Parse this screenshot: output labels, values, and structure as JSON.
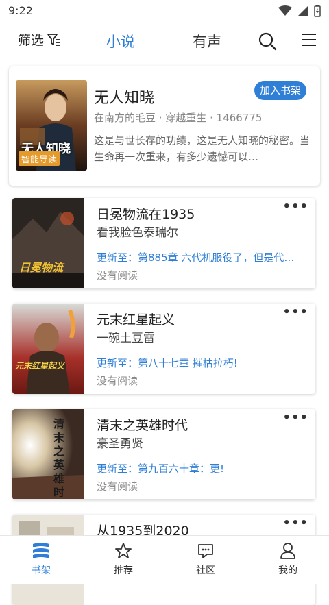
{
  "status": {
    "time": "9:22"
  },
  "topnav": {
    "filter_label": "筛选",
    "tabs": [
      "小说",
      "有声"
    ]
  },
  "featured": {
    "title": "无人知晓",
    "meta": "在南方的毛豆 · 穿越重生 · 1466775",
    "description": "这是与世长存的功绩，这是无人知晓的秘密。当生命再一次重来，有多少遗憾可以…",
    "add_label": "加入书架",
    "cover_title": "无人知晓",
    "cover_badge": "智能导读"
  },
  "books": [
    {
      "title": "日冕物流在1935",
      "author": "看我脸色泰瑞尔",
      "update": "更新至：第885章 六代机服役了，但是代…",
      "read_status": "没有阅读",
      "cover_text": "日冕物流"
    },
    {
      "title": "元末红星起义",
      "author": "一碗土豆雷",
      "update": "更新至：第八十七章 摧枯拉朽!",
      "read_status": "没有阅读",
      "cover_text": "元末红星起义"
    },
    {
      "title": "清末之英雄时代",
      "author": "豪圣勇贤",
      "update": "更新至：第九百六十章：更!",
      "read_status": "没有阅读",
      "cover_text": "清末之英雄时代"
    },
    {
      "title": "从1935到2020",
      "author": "",
      "update": "",
      "read_status": "",
      "cover_text": ""
    }
  ],
  "bottomnav": [
    "书架",
    "推荐",
    "社区",
    "我的"
  ],
  "colors": {
    "accent": "#2f7fd6"
  }
}
